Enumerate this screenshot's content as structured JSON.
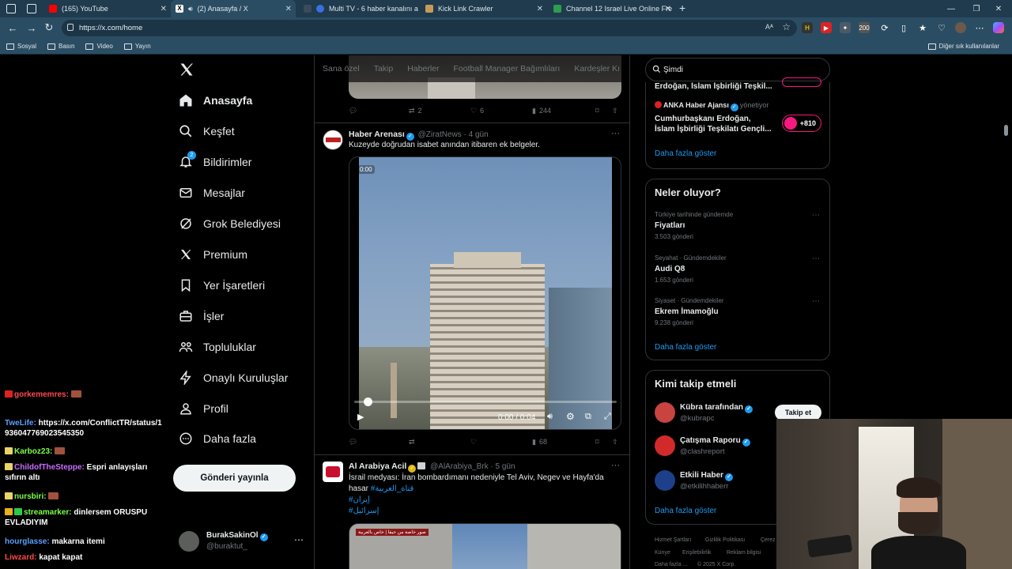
{
  "browser": {
    "tabs": [
      {
        "title": "(165) YouTube",
        "icon_color": "#ff0000"
      },
      {
        "title": "(2) Anasayfa / X",
        "icon_color": "#000000"
      },
      {
        "title": "Multi TV - 6 haber kanalını a",
        "icon_color": "#3b6fe0"
      },
      {
        "title": "Kick Link Crawler",
        "icon_color": "#c79a5b"
      },
      {
        "title": "Channel 12 Israel Live Online Fre",
        "icon_color": "#2e9d4f"
      }
    ],
    "new_tab": "+",
    "url": "https://x.com/home",
    "bookmarks": [
      "Sosyal",
      "Basın",
      "Video",
      "Yayın"
    ],
    "other_bookmarks": "Diğer sık kullanılanlar"
  },
  "nav": {
    "items": [
      {
        "label": "Anasayfa",
        "icon": "home-icon"
      },
      {
        "label": "Keşfet",
        "icon": "search-icon"
      },
      {
        "label": "Bildirimler",
        "icon": "bell-icon",
        "badge": "2"
      },
      {
        "label": "Mesajlar",
        "icon": "mail-icon"
      },
      {
        "label": "Grok Belediyesi",
        "icon": "grok-icon"
      },
      {
        "label": "Premium",
        "icon": "x-logo-icon"
      },
      {
        "label": "Yer İşaretleri",
        "icon": "bookmark-icon"
      },
      {
        "label": "İşler",
        "icon": "briefcase-icon"
      },
      {
        "label": "Topluluklar",
        "icon": "people-icon"
      },
      {
        "label": "Onaylı Kuruluşlar",
        "icon": "lightning-icon"
      },
      {
        "label": "Profil",
        "icon": "person-icon"
      },
      {
        "label": "Daha fazla",
        "icon": "more-circle-icon"
      }
    ],
    "post_button": "Gönderi yayınla",
    "account": {
      "name": "BurakSakinOl",
      "handle": "@buraktut_"
    }
  },
  "chat": [
    {
      "user": "gorkememres:",
      "message": "",
      "user_color": "#ff4a4a"
    },
    {
      "user": "TweLife:",
      "message": "https://x.com/ConflictTR/status/1936047769023545350",
      "user_color": "#5aa0ff"
    },
    {
      "user": "Karboz23:",
      "message": "",
      "user_color": "#7cff4a"
    },
    {
      "user": "ChildofTheSteppe:",
      "message": "Espri anlayışları sıfırın altı",
      "user_color": "#c86bff"
    },
    {
      "user": "nursbiri:",
      "message": "",
      "user_color": "#7cff4a"
    },
    {
      "user": "streamarker:",
      "message": "dinlersem ORUSPU EVLADIYIM",
      "user_color": "#7cff4a"
    },
    {
      "user": "hourglasse:",
      "message": "makarna itemi",
      "user_color": "#5aa0ff"
    },
    {
      "user": "Liwzard:",
      "message": "kapat kapat",
      "user_color": "#ff4a4a"
    }
  ],
  "feed": {
    "tabs": [
      "Sana özel",
      "Takip",
      "Haberler",
      "Football Manager Bağımlıları",
      "Kardeşler Kı"
    ],
    "top_actions": {
      "retweets": "2",
      "likes": "6",
      "views": "244"
    },
    "tweets": [
      {
        "name": "Haber Arenası",
        "handle": "@ZiratNews",
        "time": "4 gün",
        "text": "Kuzeyde doğrudan isabet anından itibaren ek belgeler.",
        "video_time": "0:00 / 0:04",
        "video_corner": "0:00",
        "views": "68"
      },
      {
        "name": "Al Arabiya Acil",
        "handle": "@AlArabiya_Brk",
        "time": "5 gün",
        "text": "İsrail medyası: İran bombardımanı nedeniyle Tel Aviv, Negev ve Hayfa'da hasar",
        "tags": [
          "#قناة_العربية",
          "#إيران",
          "#إسرائيل"
        ],
        "image_caption": "صور خاصة من حيفا | خاص بالعربية"
      }
    ]
  },
  "right": {
    "search_value": "Şimdi",
    "live": {
      "partial_text": "Erdoğan, İslam İşbirliği Teşkil...",
      "source": "ANKA Haber Ajansı",
      "source_role": "yönetiyor",
      "headline": "Cumhurbaşkanı Erdoğan, İslam İşbirliği Teşkilatı Gençli...",
      "count": "+810",
      "more": "Daha fazla göster"
    },
    "trends": {
      "title": "Neler oluyor?",
      "items": [
        {
          "meta": "Türkiye tarihinde gündemde",
          "name": "Fiyatları",
          "count": "3.503 gönderi"
        },
        {
          "meta": "Seyahat · Gündemdekiler",
          "name": "Audi Q8",
          "count": "1.653 gönderi"
        },
        {
          "meta": "Siyaset · Gündemdekiler",
          "name": "Ekrem İmamoğlu",
          "count": "9.238 gönderi"
        }
      ],
      "more": "Daha fazla göster"
    },
    "who_to_follow": {
      "title": "Kimi takip etmeli",
      "items": [
        {
          "name": "Kübra tarafından",
          "handle": "@kubrapc",
          "avatar_color": "#c9433f"
        },
        {
          "name": "Çatışma Raporu",
          "handle": "@clashreport",
          "avatar_color": "#d22a2a"
        },
        {
          "name": "Etkili Haber",
          "handle": "@etkilihhaberr",
          "avatar_color": "#1e3f8a"
        }
      ],
      "follow_label": "Takip et",
      "more": "Daha fazla göster"
    },
    "footer": [
      "Hizmet Şartları",
      "Gizlilik Politikası",
      "Çerez",
      "Künye",
      "Erişilebilirlik",
      "Reklam bilgisi",
      "Daha fazla ...",
      "© 2025 X Corp."
    ]
  },
  "colors": {
    "accent": "#1d9bf0",
    "background": "#000000",
    "browser": "#2b4d63"
  }
}
